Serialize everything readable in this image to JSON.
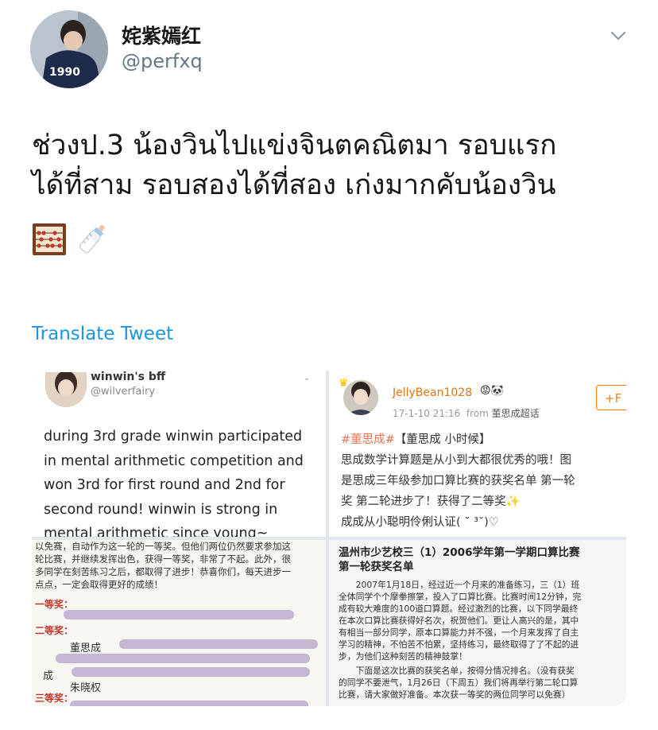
{
  "user": {
    "display_name": "姹紫嫣红",
    "handle": "@perfxq"
  },
  "tweet": {
    "text_line1": "ช่วงป.3 น้องวินไปแข่งจินตคณิตมา รอบแรก",
    "text_line2": "ได้ที่สาม รอบสองได้ที่สอง เก่งมากคับน้องวิน",
    "emojis": [
      "abacus-icon",
      "baby-bottle-icon"
    ],
    "translate_label": "Translate Tweet"
  },
  "media": {
    "card1": {
      "name": "winwin's bff",
      "handle": "@wilverfairy",
      "lines": [
        "during 3rd grade winwin participated",
        "in mental arithmetic competition and",
        "won 3rd for first round and 2nd for",
        "second round! winwin is strong in",
        "mental arithmetic since young~"
      ]
    },
    "card2": {
      "name": "JellyBean1028",
      "time": "17-1-10 21:16",
      "from_label": "from",
      "source": "董思成超话",
      "follow_label": "+F",
      "hashtag": "#董思成#",
      "title": "【董思成 小时候】",
      "lines": [
        "思成数学计算题是从小到大都很优秀的哦！图",
        "是思成三年级参加口算比赛的获奖名单 第一轮",
        "奖 第二轮进步了！获得了二等奖✨",
        "成成从小聪明伶俐认证( ˘ ³˘)♡"
      ]
    },
    "card3": {
      "lines": [
        "以免赛，自动作为这一轮的一等奖。但他们两位仍然要求参加这",
        "轮比赛，并继续发挥出色，获得一等奖，非常了不起。此外，很",
        "多同学在刻苦练习之后，都取得了进步！恭喜你们，每天进步一",
        "点点，一定会取得更好的成绩！"
      ],
      "first_prize": "一等奖：",
      "second_prize": "二等奖：",
      "third_prize": "三等奖：",
      "names": [
        "董思成",
        "朱晓权",
        "成"
      ]
    },
    "card4": {
      "title_line1": "温州市少艺校三（1）2006学年第一学期口算比赛",
      "title_line2": "第一轮获奖名单",
      "lines": [
        "　　2007年1月18日，经过近一个月来的准备练习，三（1）班",
        "全体同学个个摩拳擦掌，投入了口算比赛。比赛时间12分钟，完",
        "成有较大难度的100道口算题。经过激烈的比赛，以下同学最终",
        "在本次口算比赛获得好名次，祝贺他们。更让人高兴的是，其中",
        "有相当一部分同学，原本口算能力并不强，一个月来发挥了自主",
        "学习的精神，不怕苦不怕累，坚持练习，最终取得了了不起的进",
        "步，为他们这种刻苦的精神鼓掌！",
        "　　下面是这次比赛的获奖名单，按得分情况排名。（没有获奖",
        "的同学不要泄气，1月26日（下周五）我们将再举行第二轮口算",
        "比赛，请大家做好准备。本次获一等奖的两位同学可以免赛）"
      ]
    }
  }
}
